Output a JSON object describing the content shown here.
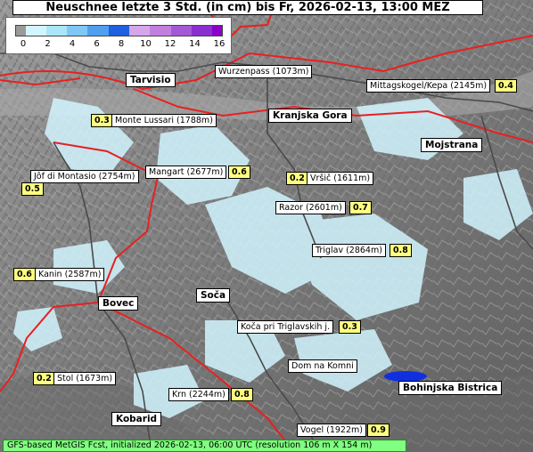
{
  "title": "Neuschnee letzte 3 Std. (in cm) bis Fr, 2026-02-13, 13:00 MEZ",
  "legend": {
    "ticks": [
      "0",
      "2",
      "4",
      "6",
      "8",
      "10",
      "12",
      "14",
      "16"
    ],
    "colors": [
      "#d2f5ff",
      "#a9e6fa",
      "#7fc8f6",
      "#4f9ef0",
      "#1f5fe0",
      "#d6a6ea",
      "#c27fe0",
      "#a45ad6",
      "#8a2fd0"
    ],
    "min_color": "#9a9a9a",
    "max_color": "#8a00c8"
  },
  "towns": [
    {
      "name": "Tarvisio"
    },
    {
      "name": "Kranjska Gora"
    },
    {
      "name": "Mojstrana"
    },
    {
      "name": "Bovec"
    },
    {
      "name": "Soča"
    },
    {
      "name": "Bohinjska Bistrica"
    },
    {
      "name": "Kobarid"
    }
  ],
  "points": [
    {
      "name": "Wurzenpass (1073m)",
      "value": ""
    },
    {
      "name": "Mittagskogel/Kepa (2145m)",
      "value": "0.4"
    },
    {
      "name": "Monte Lussari (1788m)",
      "value": "0.3"
    },
    {
      "name": "Jôf di Montasio (2754m)",
      "value": "0.5"
    },
    {
      "name": "Mangart (2677m)",
      "value": "0.6"
    },
    {
      "name": "Vršič (1611m)",
      "value": "0.2"
    },
    {
      "name": "Razor (2601m)",
      "value": "0.7"
    },
    {
      "name": "Triglav (2864m)",
      "value": "0.8"
    },
    {
      "name": "Kanin (2587m)",
      "value": "0.6"
    },
    {
      "name": "Koča pri Triglavskih j.",
      "value": "0.3"
    },
    {
      "name": "Dom na Komni",
      "value": ""
    },
    {
      "name": "Stol (1673m)",
      "value": "0.2"
    },
    {
      "name": "Krn (2244m)",
      "value": "0.8"
    },
    {
      "name": "Vogel (1922m)",
      "value": "0.9"
    }
  ],
  "footer": "GFS-based MetGIS Fcst, initialized 2026-02-13, 06:00 UTC  (resolution 106 m X 154 m)",
  "colors": {
    "border_line": "#e82020",
    "road_line": "#5a5a5a",
    "value_bg": "#ffff80",
    "footer_bg": "#80ff80",
    "lake": "#1030e0"
  }
}
